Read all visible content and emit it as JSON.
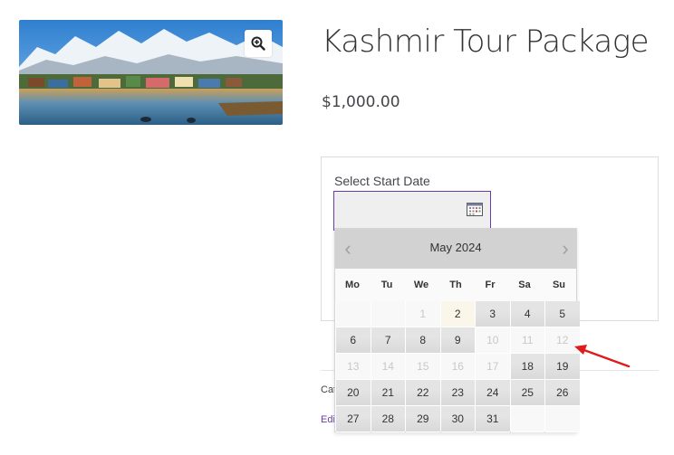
{
  "product": {
    "title": "Kashmir Tour Package",
    "price": "$1,000.00",
    "image_alt": "Dal Lake with snow-capped mountains"
  },
  "booking": {
    "start_date_label": "Select Start Date",
    "date_value": ""
  },
  "meta": {
    "category_label_partial": "Cat",
    "edit_link_partial": "Edi"
  },
  "datepicker": {
    "month_label": "May 2024",
    "weekdays": [
      "Mo",
      "Tu",
      "We",
      "Th",
      "Fr",
      "Sa",
      "Su"
    ],
    "weeks": [
      [
        {
          "d": "",
          "s": "empty"
        },
        {
          "d": "",
          "s": "empty"
        },
        {
          "d": "1",
          "s": "disabled"
        },
        {
          "d": "2",
          "s": "today"
        },
        {
          "d": "3",
          "s": "avail"
        },
        {
          "d": "4",
          "s": "avail"
        },
        {
          "d": "5",
          "s": "avail"
        }
      ],
      [
        {
          "d": "6",
          "s": "avail"
        },
        {
          "d": "7",
          "s": "avail"
        },
        {
          "d": "8",
          "s": "avail"
        },
        {
          "d": "9",
          "s": "avail"
        },
        {
          "d": "10",
          "s": "disabled"
        },
        {
          "d": "11",
          "s": "disabled"
        },
        {
          "d": "12",
          "s": "disabled"
        }
      ],
      [
        {
          "d": "13",
          "s": "disabled"
        },
        {
          "d": "14",
          "s": "disabled"
        },
        {
          "d": "15",
          "s": "disabled"
        },
        {
          "d": "16",
          "s": "disabled"
        },
        {
          "d": "17",
          "s": "disabled"
        },
        {
          "d": "18",
          "s": "avail"
        },
        {
          "d": "19",
          "s": "avail"
        }
      ],
      [
        {
          "d": "20",
          "s": "avail"
        },
        {
          "d": "21",
          "s": "avail"
        },
        {
          "d": "22",
          "s": "avail"
        },
        {
          "d": "23",
          "s": "avail"
        },
        {
          "d": "24",
          "s": "avail"
        },
        {
          "d": "25",
          "s": "avail"
        },
        {
          "d": "26",
          "s": "avail"
        }
      ],
      [
        {
          "d": "27",
          "s": "avail"
        },
        {
          "d": "28",
          "s": "avail"
        },
        {
          "d": "29",
          "s": "avail"
        },
        {
          "d": "30",
          "s": "avail"
        },
        {
          "d": "31",
          "s": "avail"
        },
        {
          "d": "",
          "s": "empty"
        },
        {
          "d": "",
          "s": "empty"
        }
      ]
    ]
  },
  "icons": {
    "zoom": "magnifier-plus-icon",
    "calendar": "calendar-icon",
    "prev": "chevron-left-icon",
    "next": "chevron-right-icon",
    "annotation": "red-arrow-annotation"
  },
  "colors": {
    "accent": "#6b3aa5",
    "annotation": "#e01b1b",
    "header_bg": "#d2d2d2"
  }
}
